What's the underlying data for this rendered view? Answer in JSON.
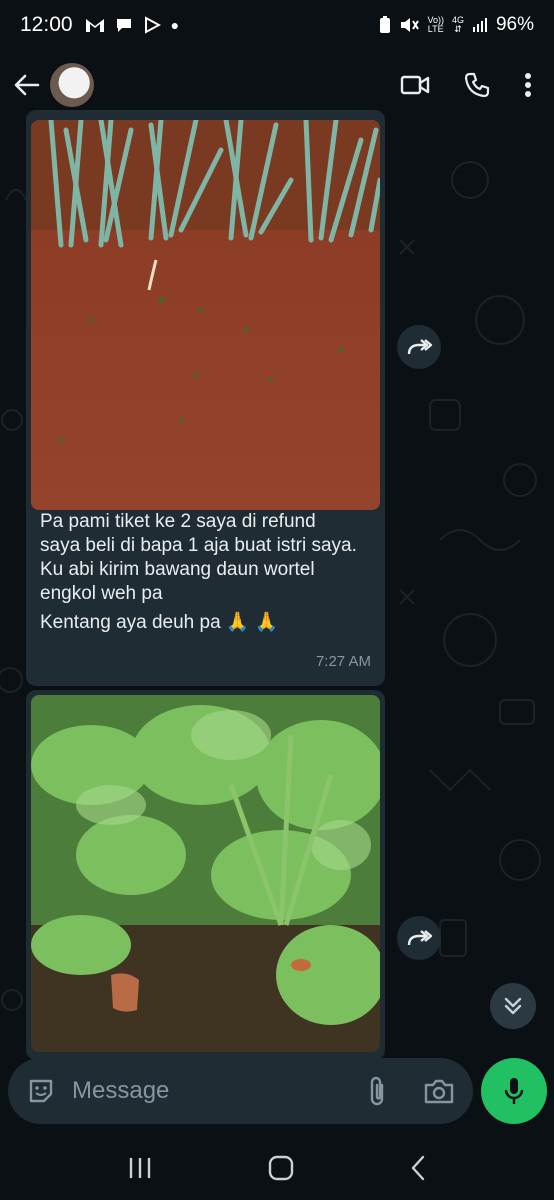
{
  "status_bar": {
    "time": "12:00",
    "network_top": "Vo))",
    "network_bottom": "LTE",
    "gen_top": "4G",
    "battery": "96%"
  },
  "header": {
    "contact_name": ""
  },
  "messages": [
    {
      "type": "image",
      "caption_lines": [
        "Pa pami tiket ke 2 saya di refund",
        "saya beli di bapa 1 aja buat istri saya.",
        "Ku abi kirim bawang daun wortel",
        "engkol weh pa"
      ],
      "last_line": "Kentang aya deuh pa 🙏 🙏",
      "time": "7:27 AM"
    },
    {
      "type": "image",
      "caption_lines": [],
      "time": ""
    }
  ],
  "composer": {
    "placeholder": "Message"
  },
  "colors": {
    "background": "#0b1014",
    "bubble": "#1f2c34",
    "accent_green": "#21c063",
    "muted_text": "#8696a0"
  },
  "icons": [
    "back-arrow-icon",
    "video-call-icon",
    "phone-icon",
    "more-vert-icon",
    "forward-icon",
    "scroll-down-icon",
    "sticker-icon",
    "attach-icon",
    "camera-icon",
    "mic-icon",
    "recents-icon",
    "home-icon",
    "back-nav-icon"
  ]
}
